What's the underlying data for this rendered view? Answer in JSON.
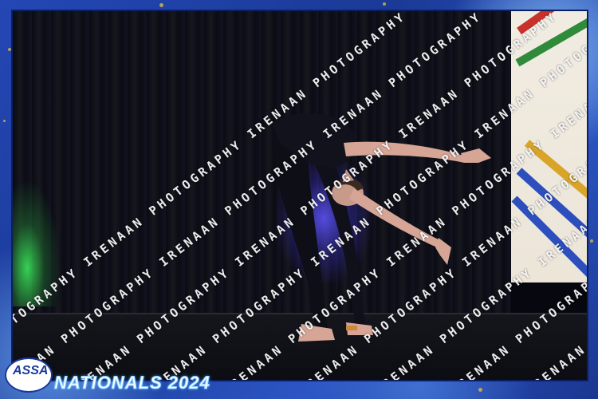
{
  "photo": {
    "subject": "dancer performing on stage",
    "colors": {
      "curtain": "#0a0b12",
      "stage_light_blue": "#5f55ff",
      "stage_light_green": "#3ce65a",
      "frame_blue": "#2447b5"
    }
  },
  "watermark": {
    "text": "IRENAAN PHOTOGRAPHY"
  },
  "branding": {
    "logo_text": "ASSA",
    "event_title": "NATIONALS 2024"
  }
}
